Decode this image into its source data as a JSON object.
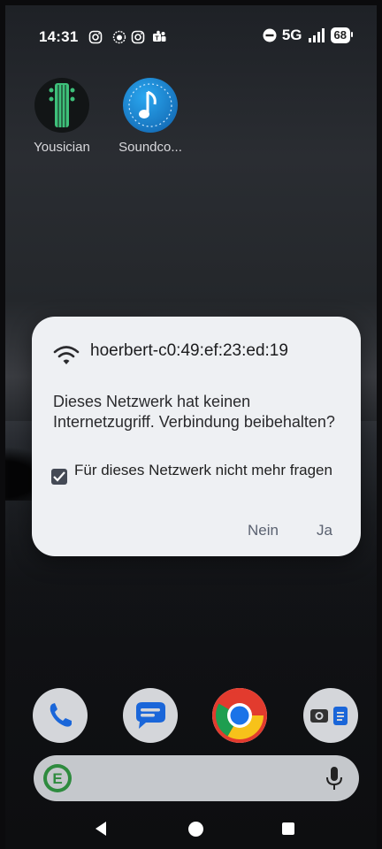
{
  "statusbar": {
    "time": "14:31",
    "notification_icons": [
      "instagram-icon",
      "lion-app-icon",
      "instagram-icon",
      "teams-icon"
    ],
    "dnd_icon": "do-not-disturb-icon",
    "network": "5G",
    "signal_icon": "signal-bars-icon",
    "battery": "68"
  },
  "home": {
    "apps": [
      {
        "label": "Yousician",
        "icon": "guitar-icon"
      },
      {
        "label": "Soundco...",
        "icon": "music-note-icon"
      }
    ]
  },
  "dialog": {
    "icon": "wifi-icon",
    "title": "hoerbert-c0:49:ef:23:ed:19",
    "message": "Dieses Netzwerk hat keinen Internetzugriff. Verbindung beibehalten?",
    "checkbox_label": "Für dieses Netzwerk nicht mehr fragen",
    "checkbox_checked": true,
    "no_label": "Nein",
    "yes_label": "Ja"
  },
  "dock": {
    "apps": [
      "phone-icon",
      "messages-icon",
      "chrome-icon",
      "camera-files-folder-icon"
    ],
    "search": {
      "logo": "ecosia-logo-icon",
      "mic": "microphone-icon"
    }
  },
  "colors": {
    "dialog_bg": "#eef0f3",
    "button_text": "#5a6170",
    "checkbox": "#444a55"
  }
}
